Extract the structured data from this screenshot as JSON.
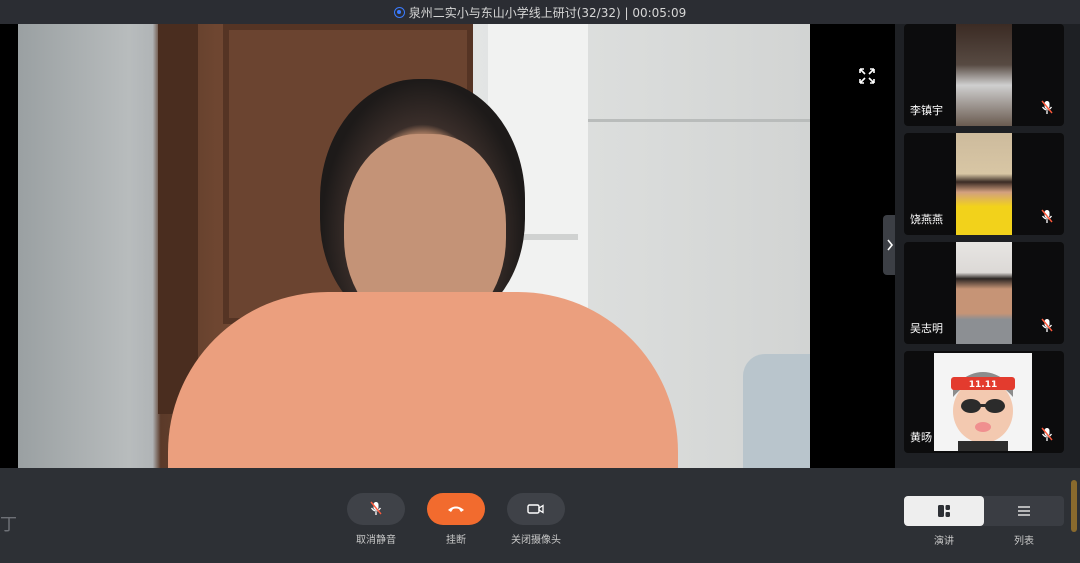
{
  "window": {
    "title": "泉州二实小与东山小学线上研讨(32/32) | 00:05:09"
  },
  "participants": [
    {
      "name": "李镇宇",
      "cam_color": "#4e4440"
    },
    {
      "name": "饶燕燕",
      "cam_color": "#d9c7a8"
    },
    {
      "name": "吴志明",
      "cam_color": "#d6d4d2"
    },
    {
      "name": "黄旸",
      "cam_color": "#f4f4f4"
    }
  ],
  "avatar_badge": "11.11",
  "toolbar": {
    "partial_left": "丁",
    "mute_label": "取消静音",
    "hangup_label": "挂断",
    "camera_label": "关闭摄像头",
    "speaker_view_label": "演讲",
    "list_view_label": "列表"
  },
  "colors": {
    "accent": "#f26b2e",
    "toolbar_bg": "#2d3035",
    "side_bg": "#1e2024"
  },
  "icons": [
    "shield-icon",
    "fullscreen-icon",
    "chevron-right-icon",
    "microphone-icon",
    "hangup-icon",
    "camera-icon",
    "speaker-view-icon",
    "list-view-icon"
  ]
}
